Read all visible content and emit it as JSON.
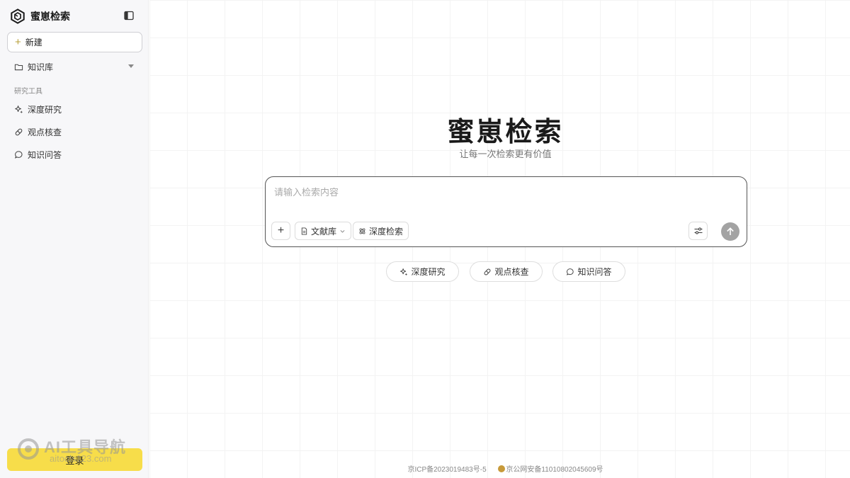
{
  "brand": {
    "name": "蜜崽检索"
  },
  "sidebar": {
    "new_label": "新建",
    "knowledge_base_label": "知识库",
    "section_title": "研究工具",
    "tools": [
      {
        "label": "深度研究",
        "icon": "sparkle-icon"
      },
      {
        "label": "观点核查",
        "icon": "pill-check-icon"
      },
      {
        "label": "知识问答",
        "icon": "chat-bubble-icon"
      }
    ],
    "login_label": "登录",
    "watermark": {
      "title": "AI工具导航",
      "subtitle": "aitools123.com"
    }
  },
  "hero": {
    "title": "蜜崽检索",
    "subtitle": "让每一次检索更有价值"
  },
  "search": {
    "placeholder": "请输入检索内容",
    "value": "",
    "library_label": "文献库",
    "deep_search_label": "深度检索"
  },
  "chips": [
    {
      "label": "深度研究"
    },
    {
      "label": "观点核查"
    },
    {
      "label": "知识问答"
    }
  ],
  "footer": {
    "icp": "京ICP备2023019483号-5",
    "police": "京公网安备11010802045609号"
  },
  "colors": {
    "accent": "#f7dd4a",
    "sidebar_bg": "#f7f7f9",
    "send_button": "#a3a3a3"
  }
}
